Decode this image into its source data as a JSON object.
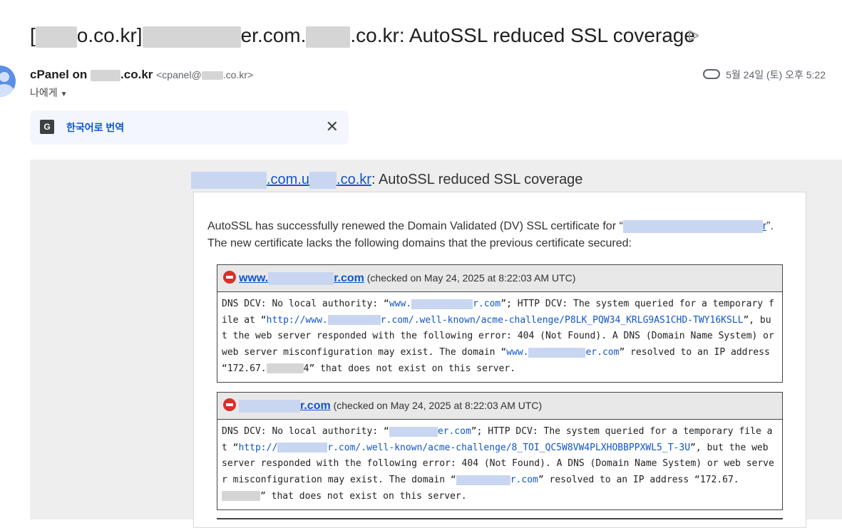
{
  "subject": {
    "prefix": "[",
    "part1": "o.co.kr]",
    "part2": "er.com.",
    "part3": ".co.kr: AutoSSL reduced SSL coverage"
  },
  "sender": {
    "name_prefix": "cPanel on ",
    "name_suffix": ".co.kr",
    "email_prefix": "<cpanel@",
    "email_suffix": ".co.kr>"
  },
  "recipient": {
    "label": "나에게"
  },
  "date": "5월 24일 (토) 오후 5:22",
  "translate": {
    "label": "한국어로 번역"
  },
  "message": {
    "title_link_a": ".com.u",
    "title_link_b": ".co.kr",
    "title_rest": ": AutoSSL reduced SSL coverage",
    "intro_before": "AutoSSL has successfully renewed the Domain Validated (DV) SSL certificate for “",
    "intro_link_tail": "r",
    "intro_after": "”. The new certificate lacks the following domains that the previous certificate secured:"
  },
  "domains": [
    {
      "name_prefix": "www.",
      "name_suffix": "r.com",
      "checked": "(checked on May 24, 2025 at 8:22:03 AM UTC)",
      "t1": "DNS DCV: No local authority: “",
      "l1a": "www.",
      "l1b": "r.com",
      "t2": "”; HTTP DCV: The system queried for a temporary file at “",
      "l2a": "http://www.",
      "l2b": "r.com/.well-known/acme-challenge/P8LK_PQW34_KRLG9AS1CHD-TWY16KSLL",
      "t3": "”, but the web server responded with the following error: 404 (Not Found). A DNS (Domain Name System) or web server misconfiguration may exist. The domain “",
      "l3a": "www.",
      "l3b": "er.com",
      "t4": "” resolved to an IP address “172.67.",
      "t4b": "4” that does not exist on this server."
    },
    {
      "name_prefix": "",
      "name_suffix": "r.com",
      "checked": "(checked on May 24, 2025 at 8:22:03 AM UTC)",
      "t1": "DNS DCV: No local authority: “",
      "l1a": "",
      "l1b": "er.com",
      "t2": "”; HTTP DCV: The system queried for a temporary file at “",
      "l2a": "http://",
      "l2b": "r.com/.well-known/acme-challenge/8_TOI_QC5W8VW4PLXHOBBPPXWL5_T-3U",
      "t3": "”, but the web server responded with the following error: 404 (Not Found). A DNS (Domain Name System) or web server misconfiguration may exist. The domain “",
      "l3a": "",
      "l3b": "r.com",
      "t4": "” resolved to an IP address “172.67.",
      "t4b": "” that does not exist on this server."
    }
  ]
}
